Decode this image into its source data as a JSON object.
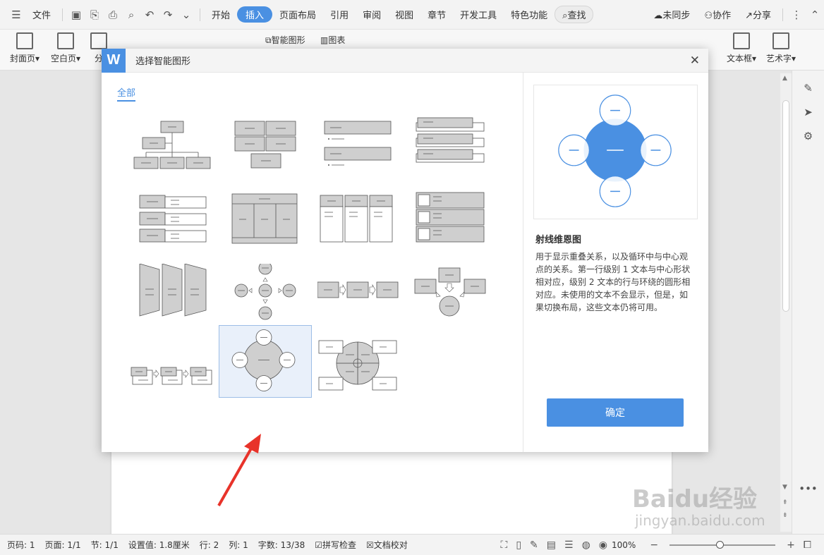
{
  "menubar": {
    "file_label": "文件",
    "tabs": [
      "开始",
      "插入",
      "页面布局",
      "引用",
      "审阅",
      "视图",
      "章节",
      "开发工具",
      "特色功能"
    ],
    "active_tab": "插入",
    "search_label": "查找",
    "sync_label": "未同步",
    "collab_label": "协作",
    "share_label": "分享"
  },
  "ribbon": {
    "cover_page": "封面页",
    "blank_page": "空白页",
    "page_break": "分",
    "smart_art": "智能图形",
    "chart": "图表",
    "text_box": "文本框",
    "word_art": "艺术字"
  },
  "dialog": {
    "logo": "W",
    "title": "选择智能图形",
    "category": "全部",
    "preview_title": "射线维恩图",
    "preview_desc": "用于显示重叠关系，以及循环中与中心观点的关系。第一行级别 1 文本与中心形状相对应，级别 2 文本的行与环绕的圆形相对应。未使用的文本不会显示，但是，如果切换布局，这些文本仍将可用。",
    "ok_label": "确定"
  },
  "statusbar": {
    "page_code": "页码: 1",
    "page": "页面: 1/1",
    "section": "节: 1/1",
    "setting": "设置值: 1.8厘米",
    "row": "行: 2",
    "col": "列: 1",
    "word_count": "字数: 13/38",
    "spell_check": "拼写检查",
    "doc_proof": "文档校对",
    "zoom": "100%"
  },
  "watermark": {
    "brand": "Baidu经验",
    "url": "jingyan.baidu.com"
  },
  "colors": {
    "accent": "#4a90e2",
    "arrow": "#e8332a"
  }
}
